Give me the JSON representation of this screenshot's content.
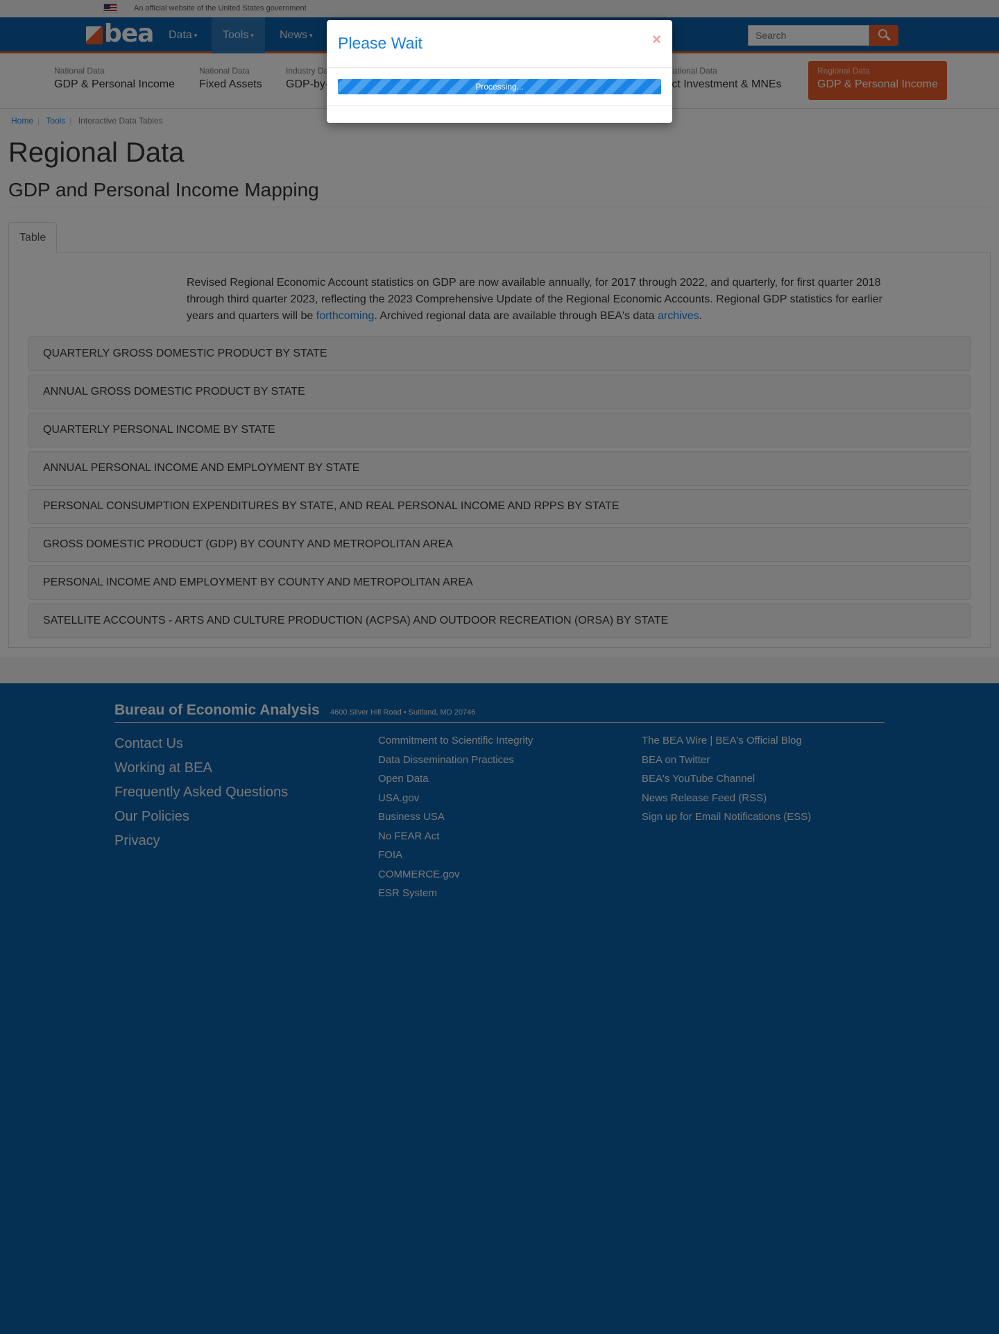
{
  "gov_banner": {
    "text": "An official website of the United States government"
  },
  "navbar": {
    "logo_text": "bea",
    "items": [
      {
        "label": "Data",
        "caret": "▾"
      },
      {
        "label": "Tools",
        "caret": "▾"
      },
      {
        "label": "News",
        "caret": "▾"
      }
    ],
    "search_placeholder": "Search"
  },
  "data_nav": [
    {
      "category": "National Data",
      "name": "GDP & Personal Income"
    },
    {
      "category": "National Data",
      "name": "Fixed Assets"
    },
    {
      "category": "Industry Data",
      "name": "GDP-by-Industry"
    },
    {
      "category": "International Data",
      "name": "Direct Investment & MNEs"
    },
    {
      "category": "Regional Data",
      "name": "GDP & Personal Income"
    }
  ],
  "breadcrumb": {
    "home": "Home",
    "tools": "Tools",
    "current": "Interactive Data Tables"
  },
  "page": {
    "title": "Regional Data",
    "subtitle": "GDP and Personal Income Mapping",
    "tab": "Table"
  },
  "intro": {
    "text1": "Revised Regional Economic Account statistics on GDP are now available annually, for 2017 through 2022, and quarterly, for first quarter 2018 through third quarter 2023, reflecting the 2023 Comprehensive Update of the Regional Economic Accounts. Regional GDP statistics for earlier years and quarters will be ",
    "link1": "forthcoming",
    "text2": ". Archived regional data are available through BEA's data ",
    "link2": "archives",
    "text3": "."
  },
  "accordions": [
    "QUARTERLY GROSS DOMESTIC PRODUCT BY STATE",
    "ANNUAL GROSS DOMESTIC PRODUCT BY STATE",
    "QUARTERLY PERSONAL INCOME BY STATE",
    "ANNUAL PERSONAL INCOME AND EMPLOYMENT BY STATE",
    "PERSONAL CONSUMPTION EXPENDITURES BY STATE, AND REAL PERSONAL INCOME AND RPPS BY STATE",
    "GROSS DOMESTIC PRODUCT (GDP) BY COUNTY AND METROPOLITAN AREA",
    "PERSONAL INCOME AND EMPLOYMENT BY COUNTY AND METROPOLITAN AREA",
    "SATELLITE ACCOUNTS - ARTS AND CULTURE PRODUCTION (ACPSA) AND OUTDOOR RECREATION (ORSA) BY STATE"
  ],
  "footer": {
    "org": "Bureau of Economic Analysis",
    "address": "4600 Silver Hill Road • Suitland, MD 20746",
    "col1": [
      "Contact Us",
      "Working at BEA",
      "Frequently Asked Questions",
      "Our Policies",
      "Privacy"
    ],
    "col2": [
      "Commitment to Scientific Integrity",
      "Data Dissemination Practices",
      "Open Data",
      "USA.gov",
      "Business USA",
      "No FEAR Act",
      "FOIA",
      "COMMERCE.gov",
      "ESR System"
    ],
    "col3": [
      "The BEA Wire | BEA's Official Blog",
      "BEA on Twitter",
      "BEA's YouTube Channel",
      "News Release Feed (RSS)",
      "Sign up for Email Notifications (ESS)"
    ]
  },
  "modal": {
    "title": "Please Wait",
    "close": "×",
    "progress_label": "Processing...",
    "progress": 1.0
  },
  "colors": {
    "brand_blue": "#0b60a8",
    "accent_orange": "#e65c2b",
    "link_blue": "#1a7fe0"
  }
}
